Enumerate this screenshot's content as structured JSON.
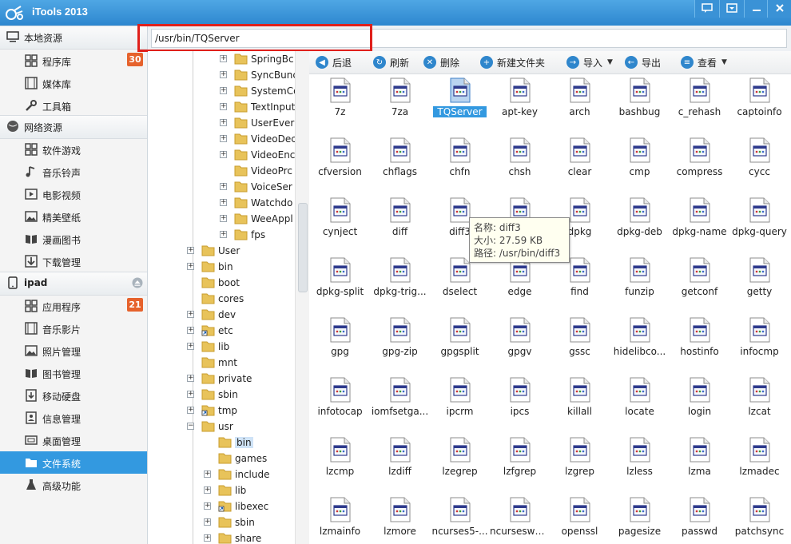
{
  "app": {
    "title": "iTools 2013"
  },
  "sidebar": {
    "local": {
      "header": "本地资源",
      "items": [
        {
          "label": "程序库",
          "badge": "30"
        },
        {
          "label": "媒体库"
        },
        {
          "label": "工具箱"
        }
      ]
    },
    "network": {
      "header": "网络资源",
      "items": [
        {
          "label": "软件游戏"
        },
        {
          "label": "音乐铃声"
        },
        {
          "label": "电影视频"
        },
        {
          "label": "精美壁纸"
        },
        {
          "label": "漫画图书"
        },
        {
          "label": "下载管理"
        }
      ]
    },
    "device": {
      "header": "ipad",
      "items": [
        {
          "label": "应用程序",
          "badge": "21"
        },
        {
          "label": "音乐影片"
        },
        {
          "label": "照片管理"
        },
        {
          "label": "图书管理"
        },
        {
          "label": "移动硬盘"
        },
        {
          "label": "信息管理"
        },
        {
          "label": "桌面管理"
        },
        {
          "label": "文件系统"
        },
        {
          "label": "高级功能"
        }
      ]
    }
  },
  "path": {
    "value": "/usr/bin/TQServer"
  },
  "tree": {
    "items": [
      "SpringBc",
      "SyncBunc",
      "SystemCo",
      "TextInput",
      "UserEver",
      "VideoDec",
      "VideoEnc",
      "VideoPrc",
      "VoiceSer",
      "Watchdo",
      "WeeAppl",
      "fps",
      "User",
      "bin",
      "boot",
      "cores",
      "dev",
      "etc",
      "lib",
      "mnt",
      "private",
      "sbin",
      "tmp",
      "usr",
      "bin",
      "games",
      "include",
      "lib",
      "libexec",
      "sbin",
      "share"
    ]
  },
  "toolbar": {
    "back": "后退",
    "refresh": "刷新",
    "delete": "删除",
    "new_folder": "新建文件夹",
    "import": "导入",
    "export": "导出",
    "view": "查看"
  },
  "files": [
    "7z",
    "7za",
    "TQServer",
    "apt-key",
    "arch",
    "bashbug",
    "c_rehash",
    "captoinfo",
    "cfversion",
    "chflags",
    "chfn",
    "chsh",
    "clear",
    "cmp",
    "compress",
    "cycc",
    "cynject",
    "diff",
    "diff3",
    "",
    "dpkg",
    "dpkg-deb",
    "dpkg-name",
    "dpkg-query",
    "dpkg-split",
    "dpkg-trig...",
    "dselect",
    "edge",
    "find",
    "funzip",
    "getconf",
    "getty",
    "gpg",
    "gpg-zip",
    "gpgsplit",
    "gpgv",
    "gssc",
    "hidelibco...",
    "hostinfo",
    "infocmp",
    "infotocap",
    "iomfsetga...",
    "ipcrm",
    "ipcs",
    "killall",
    "locate",
    "login",
    "lzcat",
    "lzcmp",
    "lzdiff",
    "lzegrep",
    "lzfgrep",
    "lzgrep",
    "lzless",
    "lzma",
    "lzmadec",
    "lzmainfo",
    "lzmore",
    "ncurses5-...",
    "ncursesw5...",
    "openssl",
    "pagesize",
    "passwd",
    "patchsync"
  ],
  "tooltip": {
    "name": "名称: diff3",
    "size": "大小: 27.59 KB",
    "path": "路径: /usr/bin/diff3"
  }
}
